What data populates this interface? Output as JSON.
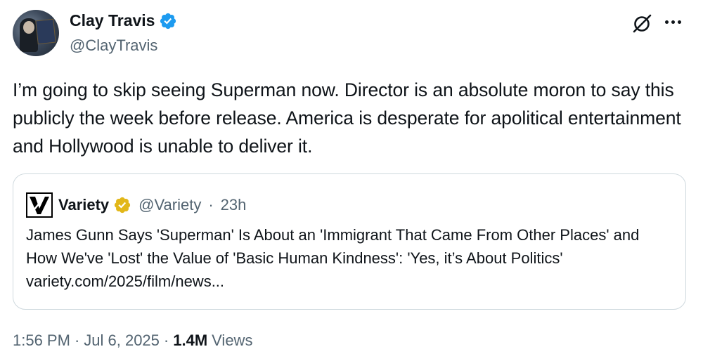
{
  "author": {
    "display_name": "Clay Travis",
    "handle": "@ClayTravis",
    "avatar_icon": "profile-avatar",
    "verified_color": "#1d9bf0"
  },
  "header_actions": {
    "grok_icon": "grok-icon",
    "more_icon": "more-icon"
  },
  "tweet": {
    "text": "I’m going to skip seeing Superman now. Director is an absolute moron to say this publicly the week before release. America is desperate for apolitical entertainment and Hollywood is unable to deliver it."
  },
  "quote": {
    "display_name": "Variety",
    "handle": "@Variety",
    "separator": "·",
    "time": "23h",
    "badge_color": "#e2b719",
    "text": "James Gunn Says 'Superman' Is About an 'Immigrant That Came From Other Places' and How We've 'Lost' the Value of 'Basic Human Kindness': 'Yes, it’s About Politics' variety.com/2025/film/news..."
  },
  "footer": {
    "time": "1:56 PM",
    "sep1": "·",
    "date": "Jul 6, 2025",
    "sep2": "·",
    "views_count": "1.4M",
    "views_label": "Views"
  }
}
